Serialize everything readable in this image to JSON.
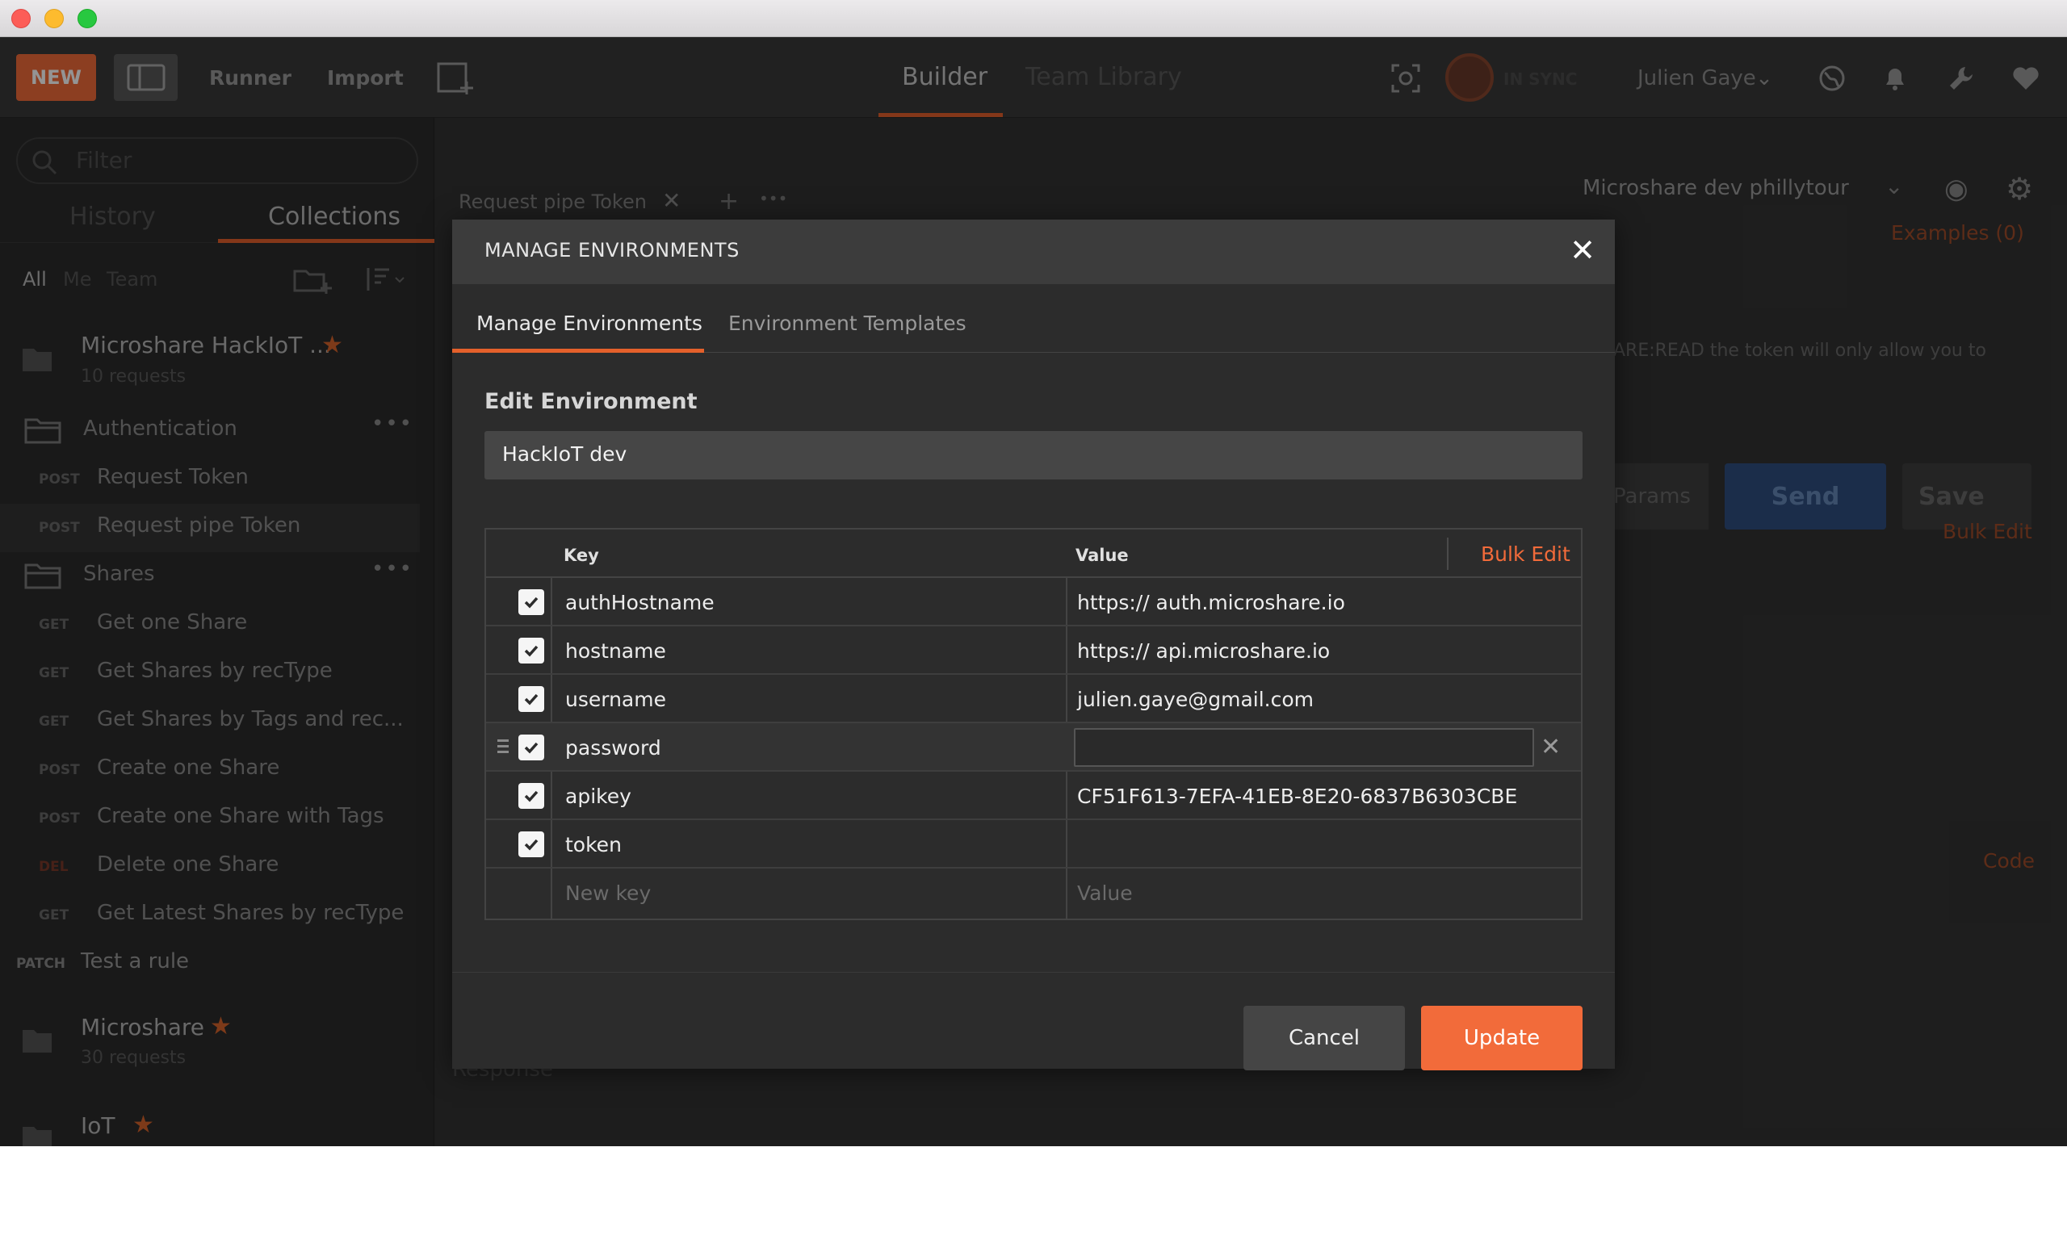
{
  "toolbar": {
    "new_label": "NEW",
    "runner_label": "Runner",
    "import_label": "Import",
    "tab_builder": "Builder",
    "tab_team_library": "Team Library",
    "sync_status": "IN SYNC",
    "user_name": "Julien Gaye"
  },
  "sidebar": {
    "filter_placeholder": "Filter",
    "tab_history": "History",
    "tab_collections": "Collections",
    "scope_all": "All",
    "scope_me": "Me",
    "scope_team": "Team",
    "collections": [
      {
        "name": "Microshare HackIoT ...",
        "sub": "10 requests"
      },
      {
        "name": "Microshare",
        "sub": "30 requests"
      },
      {
        "name": "IoT",
        "sub": ""
      }
    ],
    "items": [
      {
        "method": "",
        "label": "Authentication"
      },
      {
        "method": "POST",
        "label": "Request Token"
      },
      {
        "method": "POST",
        "label": "Request pipe Token"
      },
      {
        "method": "",
        "label": "Shares"
      },
      {
        "method": "GET",
        "label": "Get one Share"
      },
      {
        "method": "GET",
        "label": "Get Shares by recType"
      },
      {
        "method": "GET",
        "label": "Get Shares by Tags and rec..."
      },
      {
        "method": "POST",
        "label": "Create one Share"
      },
      {
        "method": "POST",
        "label": "Create one Share with Tags"
      },
      {
        "method": "DEL",
        "label": "Delete one Share"
      },
      {
        "method": "GET",
        "label": "Get Latest Shares by recType"
      },
      {
        "method": "PATCH",
        "label": "Test a rule"
      }
    ]
  },
  "main": {
    "request_tab": "Request pipe Token",
    "environment": "Microshare dev phillytour",
    "examples": "Examples (0)",
    "desc_fragment": "ARE:READ  the token will only allow you to",
    "params": "Params",
    "send": "Send",
    "save": "Save",
    "bulk_edit": "Bulk Edit",
    "code": "Code",
    "response": "Response"
  },
  "modal": {
    "title": "MANAGE ENVIRONMENTS",
    "tab_manage": "Manage Environments",
    "tab_templates": "Environment Templates",
    "edit_label": "Edit Environment",
    "env_name": "HackIoT dev",
    "col_key": "Key",
    "col_value": "Value",
    "bulk_edit": "Bulk Edit",
    "rows": [
      {
        "key": "authHostname",
        "value": "https:// auth.microshare.io"
      },
      {
        "key": "hostname",
        "value": "https:// api.microshare.io"
      },
      {
        "key": "username",
        "value": "julien.gaye@gmail.com"
      },
      {
        "key": "password",
        "value": ""
      },
      {
        "key": "apikey",
        "value": "CF51F613-7EFA-41EB-8E20-6837B6303CBE"
      },
      {
        "key": "token",
        "value": ""
      }
    ],
    "new_key_placeholder": "New key",
    "new_value_placeholder": "Value",
    "cancel": "Cancel",
    "update": "Update"
  },
  "colors": {
    "accent": "#f26b3a",
    "background": "#333333",
    "modal": "#2c2c2c"
  }
}
